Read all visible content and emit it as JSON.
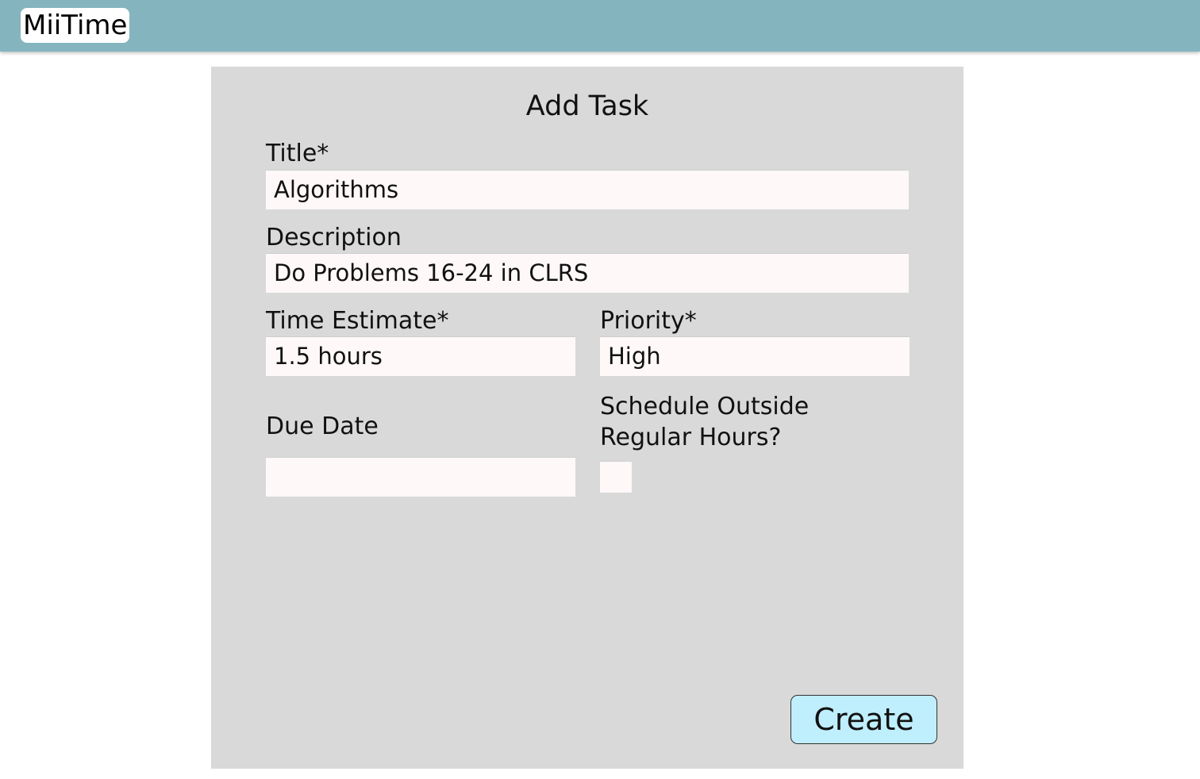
{
  "app": {
    "brand": "MiiTime"
  },
  "form": {
    "heading": "Add Task",
    "title_label": "Title*",
    "title_value": "Algorithms",
    "description_label": "Description",
    "description_value": "Do Problems 16-24 in CLRS",
    "time_estimate_label": "Time Estimate*",
    "time_estimate_value": "1.5 hours",
    "priority_label": "Priority*",
    "priority_value": "High",
    "due_date_label": "Due Date",
    "due_date_value": "",
    "schedule_outside_label_line1": "Schedule Outside",
    "schedule_outside_label_line2": "Regular Hours?",
    "schedule_outside_checked": false,
    "create_label": "Create"
  },
  "colors": {
    "topbar": "#84b5bf",
    "panel": "#d9d9d9",
    "field": "#fff8f8",
    "button": "#bfeefd"
  }
}
